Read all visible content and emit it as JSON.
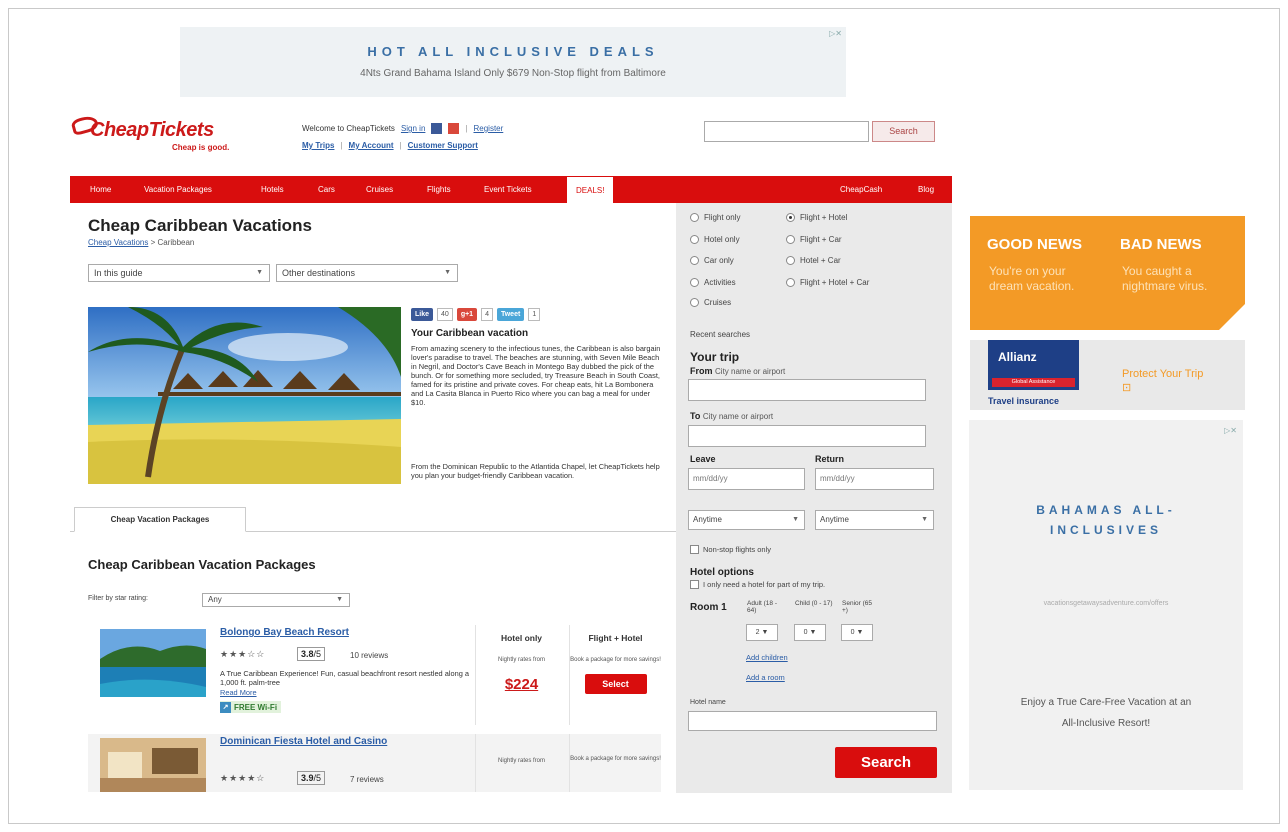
{
  "top_ad": {
    "headline": "HOT ALL INCLUSIVE DEALS",
    "subline": "4Nts Grand Bahama Island Only $679 Non-Stop flight from Baltimore",
    "adchoices": "▷✕"
  },
  "header": {
    "logo_name": "CheapTickets",
    "logo_tagline": "Cheap is good.",
    "welcome_text": "Welcome to CheapTickets",
    "sign_in": "Sign in",
    "register": "Register",
    "my_trips": "My Trips",
    "my_account": "My Account",
    "customer_support": "Customer Support",
    "search_value": "",
    "search_button": "Search"
  },
  "nav": {
    "items": [
      "Home",
      "Vacation Packages",
      "Hotels",
      "Cars",
      "Cruises",
      "Flights",
      "Event Tickets",
      "DEALS!"
    ],
    "right_items": [
      "CheapCash",
      "Blog"
    ]
  },
  "main": {
    "title": "Cheap Caribbean Vacations",
    "breadcrumb_link": "Cheap Vacations",
    "breadcrumb_current": " > Caribbean",
    "guide_select": "In this guide",
    "destinations_select": "Other destinations",
    "social": {
      "like": "Like",
      "like_count": "40",
      "gplus": "g+1",
      "gplus_count": "4",
      "tweet": "Tweet",
      "tweet_count": "1"
    },
    "intro_heading": "Your Caribbean vacation",
    "intro_p1": "From amazing scenery to the infectious tunes, the Caribbean is also bargain lover's paradise to travel. The beaches are stunning, with Seven Mile Beach in Negril, and Doctor's Cave Beach in Montego Bay dubbed the pick of the bunch. Or for something more secluded, try Treasure Beach in South Coast, famed for its pristine and private coves. For cheap eats, hit La Bombonera and La Casita Blanca in Puerto Rico where you can bag a meal for under $10.",
    "intro_p2": "From the Dominican Republic to the Atlantida Chapel, let CheapTickets help you plan your budget-friendly Caribbean vacation.",
    "tab_label": "Cheap Vacation Packages",
    "packages_heading": "Cheap Caribbean Vacation Packages",
    "filter_label": "Filter by star rating:",
    "filter_value": "Any",
    "col_hotel_only": "Hotel only",
    "col_flight_hotel": "Flight + Hotel",
    "hotels": [
      {
        "name": "Bolongo Bay Beach Resort",
        "stars": "★★★☆☆",
        "score": "3.8",
        "score_max": "/5",
        "reviews": "10 reviews",
        "description": "A True Caribbean Experience! Fun, casual beachfront resort nestled along a 1,000 ft. palm-tree",
        "read_more": "Read More",
        "amenity": "FREE Wi-Fi",
        "rate_label": "Nightly rates from",
        "price": "$224",
        "package_note": "Book a package for more savings!",
        "select": "Select"
      },
      {
        "name": "Dominican Fiesta Hotel and Casino",
        "stars": "★★★★☆",
        "score": "3.9",
        "score_max": "/5",
        "reviews": "7 reviews",
        "rate_label": "Nightly rates from",
        "package_note": "Book a package for more savings!"
      }
    ]
  },
  "booking": {
    "options": [
      "Flight only",
      "Flight + Hotel",
      "Hotel only",
      "Flight + Car",
      "Car only",
      "Hotel + Car",
      "Activities",
      "Flight + Hotel + Car",
      "Cruises"
    ],
    "selected": "Flight + Hotel",
    "recent": "Recent searches",
    "your_trip": "Your trip",
    "from_label": "From",
    "from_hint": "City name or airport",
    "to_label": "To",
    "to_hint": "City name or airport",
    "leave_label": "Leave",
    "return_label": "Return",
    "leave_placeholder": "mm/dd/yy",
    "return_placeholder": "mm/dd/yy",
    "leave_time": "Anytime",
    "return_time": "Anytime",
    "nonstop": "Non-stop flights only",
    "hotel_options": "Hotel options",
    "partial_hotel": "I only need a hotel for part of my trip.",
    "room_label": "Room 1",
    "adult_label": "Adult (18 - 64)",
    "child_label": "Child (0 - 17)",
    "senior_label": "Senior (65 +)",
    "adult_value": "2",
    "child_value": "0",
    "senior_value": "0",
    "add_children": "Add children",
    "add_room": "Add a room",
    "hotel_name_label": "Hotel name",
    "search_button": "Search"
  },
  "right_ads": {
    "good_news": "GOOD NEWS",
    "good_sub": "You're on your dream vacation.",
    "bad_news": "BAD NEWS",
    "bad_sub": "You caught a nightmare virus.",
    "allianz_name": "Allianz",
    "allianz_bar": "Global Assistance",
    "travel_insurance": "Travel insurance",
    "protect": "Protect Your Trip ⊡",
    "bahamas_heading": "BAHAMAS ALL-INCLUSIVES",
    "bahamas_url": "vacationsgetawaysadventure.com/offers",
    "bahamas_body": "Enjoy a True Care-Free Vacation at an All-Inclusive Resort!"
  },
  "colors": {
    "brand_red": "#d90d0d",
    "link_blue": "#2b5da6",
    "orange": "#f39a26",
    "allianz_blue": "#1e3f86"
  }
}
